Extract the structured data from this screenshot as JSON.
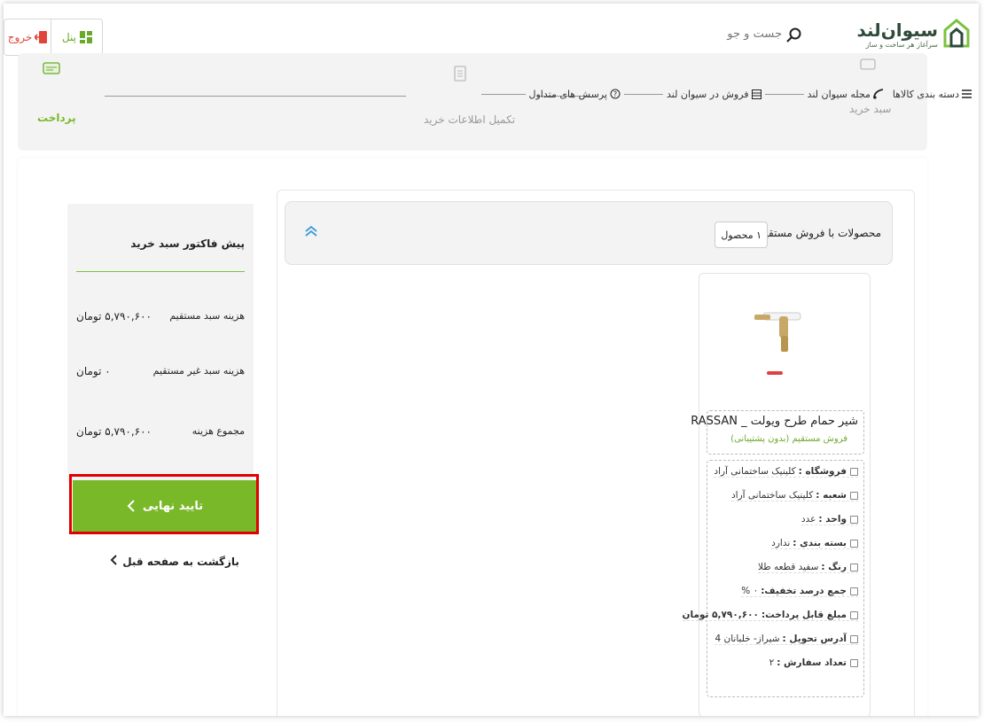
{
  "header": {
    "brand": "سیوان‌لند",
    "tagline": "سرآغاز هر ساخت و ساز",
    "search_placeholder": "جست و جو",
    "panel_label": "پنل",
    "exit_label": "خروج"
  },
  "nav": {
    "items": [
      {
        "label": "دسته بندی کالاها",
        "icon": "menu-icon"
      },
      {
        "label": "مجله سیوان لند",
        "icon": "magazine-icon"
      },
      {
        "label": "فروش در سیوان لند",
        "icon": "store-icon"
      },
      {
        "label": "پرسش های متداول",
        "icon": "question-icon"
      }
    ]
  },
  "stepper": {
    "steps": [
      {
        "label": "سبد خرید",
        "icon": "cart-icon"
      },
      {
        "label": "تکمیل اطلاعات خرید",
        "icon": "form-icon"
      },
      {
        "label": "پرداخت",
        "icon": "payment-icon"
      }
    ],
    "active_color": "#79b829"
  },
  "sidebar": {
    "title": "پیش فاکتور سبد خرید",
    "rows": [
      {
        "label": "هزینه سبد مستقیم",
        "value": "۵,۷۹۰,۶۰۰ تومان"
      },
      {
        "label": "هزینه سبد غیر مستقیم",
        "value": "۰ تومان"
      },
      {
        "label": "مجموع هزینه",
        "value": "۵,۷۹۰,۶۰۰ تومان"
      }
    ],
    "confirm_label": "تایید نهایی",
    "back_label": "بازگشت به صفحه قبل"
  },
  "products": {
    "header_title": "محصولات با فروش مستقیم",
    "count": "۱ محصول",
    "item": {
      "name": "شیر حمام طرح ویولت _ RASSAN",
      "badge": "فروش مستقیم (بدون پشتیبانی)",
      "details": [
        {
          "label": "فروشگاه :",
          "value": "کلینیک ساختمانی آراد",
          "icon": "store-icon"
        },
        {
          "label": "شعبه :",
          "value": "کلینیک ساختمانی آراد",
          "icon": "branch-icon"
        },
        {
          "label": "واحد :",
          "value": "عدد",
          "icon": "unit-icon"
        },
        {
          "label": "بسته بندی :",
          "value": "ندارد",
          "icon": "package-icon"
        },
        {
          "label": "رنگ :",
          "value": "سفید قطعه طلا",
          "icon": "color-icon"
        },
        {
          "label": "جمع درصد تخفیف:",
          "value": "۰ %",
          "icon": "percent-icon"
        },
        {
          "label": "مبلغ قابل پرداخت:",
          "value": "۵,۷۹۰,۶۰۰ تومان",
          "icon": "money-icon"
        },
        {
          "label": "آدرس تحویل :",
          "value": "شیراز- خلبانان 4",
          "icon": "location-icon"
        },
        {
          "label": "تعداد سفارش :",
          "value": "۲",
          "icon": "count-icon"
        }
      ]
    }
  },
  "colors": {
    "accent": "#79b829",
    "danger": "#e0453a",
    "highlight": "#e00000"
  }
}
